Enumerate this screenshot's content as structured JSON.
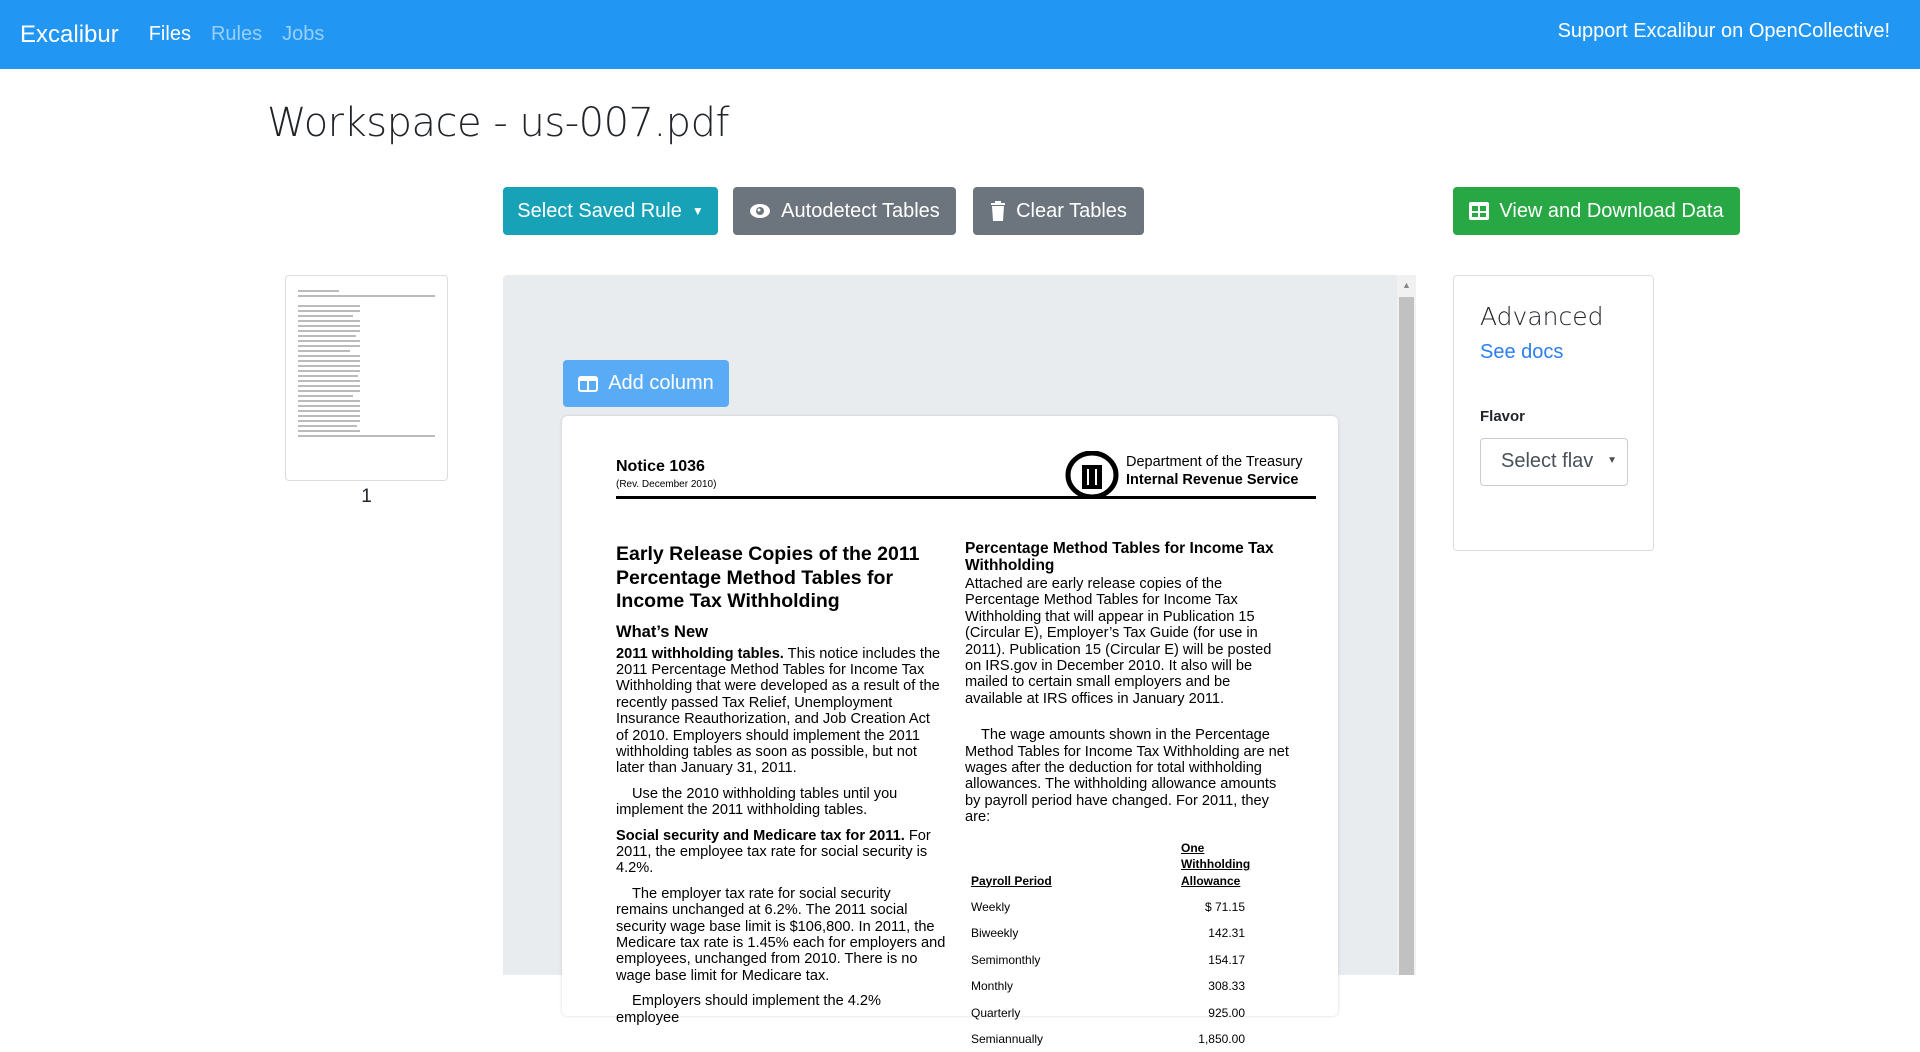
{
  "nav": {
    "brand": "Excalibur",
    "links": [
      "Files",
      "Rules",
      "Jobs"
    ],
    "support": "Support Excalibur on OpenCollective!"
  },
  "title": "Workspace - us-007.pdf",
  "toolbar": {
    "saved_rule": "Select Saved Rule",
    "autodetect": "Autodetect Tables",
    "clear": "Clear Tables",
    "download": "View and Download Data"
  },
  "colors": {
    "navbar": "#2196f3",
    "saved_rule": "#17a2b8",
    "secondary": "#6c757d",
    "success": "#28a745",
    "add_column": "#5aabf5"
  },
  "thumbnails": [
    {
      "page": "1"
    }
  ],
  "viewer": {
    "add_column": "Add column"
  },
  "pdf": {
    "notice": "Notice  1036",
    "rev": "(Rev. December 2010)",
    "agency1": "Department of the Treasury",
    "agency2": "Internal Revenue Service",
    "headline": "Early Release Copies of the 2011 Percentage Method Tables for Income Tax Withholding",
    "whats_new": "What’s New",
    "p1_bold": "2011 withholding tables.",
    "p1": "  This notice includes the 2011 Percentage Method Tables for Income Tax Withholding that were developed as a result of the recently passed Tax Relief, Unemployment Insurance Reauthorization, and Job Creation Act of 2010. Employers should implement the 2011 withholding tables as soon as possible, but not later than January 31, 2011.",
    "p2": "Use the 2010 withholding tables until you implement the 2011 withholding tables.",
    "p3_bold": "Social security and Medicare tax for 2011.",
    "p3": "  For 2011, the employee tax rate for social security is 4.2%.",
    "p4": "The employer tax rate for social security remains unchanged at 6.2%. The 2011 social security wage base limit is $106,800. In 2011, the Medicare tax rate is 1.45% each for employers and employees, unchanged from 2010. There is no wage base limit for Medicare tax.",
    "p5": "Employers should implement the 4.2% employee",
    "right_heading": "Percentage Method Tables for Income Tax Withholding",
    "r1": "Attached are early release copies of the Percentage Method Tables for Income Tax Withholding that will appear in Publication 15 (Circular E), Employer’s Tax Guide (for use in 2011). Publication 15 (Circular E) will be posted on IRS.gov in December 2010. It also will be mailed to certain small employers and be available at IRS offices in January 2011.",
    "r2": "The wage amounts shown in the Percentage Method Tables for Income Tax Withholding are net wages after the deduction for total withholding allowances. The withholding allowance amounts by payroll period have changed. For 2011, they are:",
    "table": {
      "headers": [
        "Payroll Period",
        "One Withholding Allowance"
      ],
      "rows": [
        [
          "Weekly",
          "$   71.15"
        ],
        [
          "Biweekly",
          "142.31"
        ],
        [
          "Semimonthly",
          "154.17"
        ],
        [
          "Monthly",
          "308.33"
        ],
        [
          "Quarterly",
          "925.00"
        ],
        [
          "Semiannually",
          "1,850.00"
        ]
      ]
    }
  },
  "advanced": {
    "title": "Advanced",
    "docs": "See docs",
    "flavor_label": "Flavor",
    "flavor_value": "Select flavor"
  }
}
